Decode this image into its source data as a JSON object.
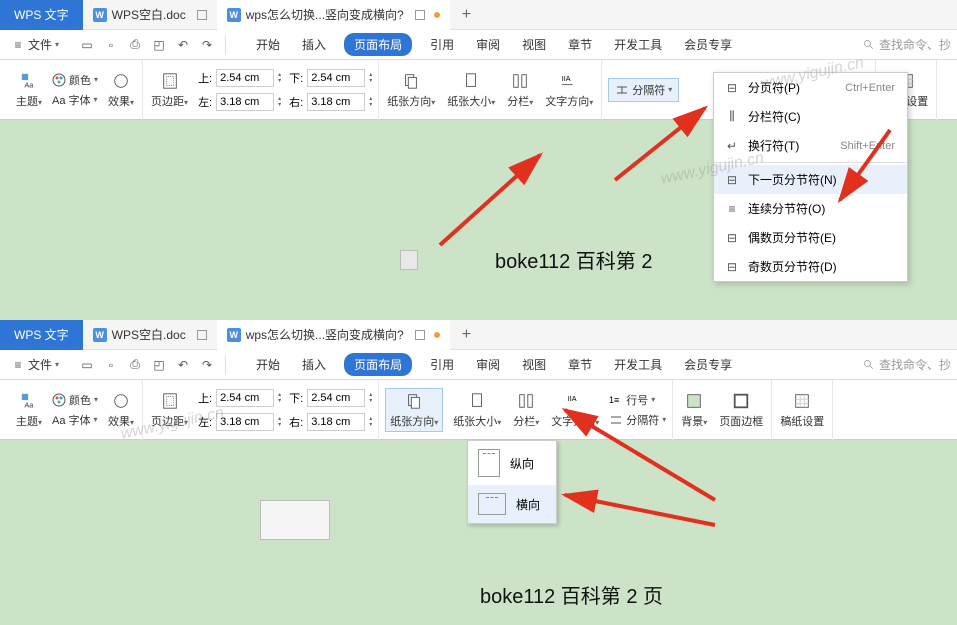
{
  "app_name": "WPS 文字",
  "tabs": {
    "t1": {
      "label": "WPS空白.doc"
    },
    "t2": {
      "label": "wps怎么切换...竖向变成横向?"
    }
  },
  "file_menu": "文件",
  "qat_icons": [
    "open",
    "save",
    "print",
    "preview",
    "undo",
    "redo"
  ],
  "ribbon_tabs": {
    "start": "开始",
    "insert": "插入",
    "page_layout": "页面布局",
    "reference": "引用",
    "review": "审阅",
    "view": "视图",
    "chapter": "章节",
    "dev": "开发工具",
    "member": "会员专享"
  },
  "search_placeholder": "查找命令、抄",
  "groups": {
    "theme": "主题",
    "font": "Aa 字体",
    "effect": "效果",
    "color": "颜色",
    "page_margin": "页边距",
    "orientation": "纸张方向",
    "paper_size": "纸张大小",
    "columns": "分栏",
    "text_dir": "文字方向",
    "line_no": "行号",
    "breaks": "分隔符",
    "background": "背景",
    "page_border": "页面边框",
    "paper_setting": "稿纸设置"
  },
  "margins": {
    "top_lbl": "上:",
    "bottom_lbl": "下:",
    "left_lbl": "左:",
    "right_lbl": "右:",
    "top": "2.54 cm",
    "bottom": "2.54 cm",
    "left": "3.18 cm",
    "right": "3.18 cm"
  },
  "breaks_menu": {
    "header": "分隔符",
    "page_break": "分页符(P)",
    "page_break_sc": "Ctrl+Enter",
    "column_break": "分栏符(C)",
    "line_break": "换行符(T)",
    "line_break_sc": "Shift+Enter",
    "next_page": "下一页分节符(N)",
    "continuous": "连续分节符(O)",
    "even_page": "偶数页分节符(E)",
    "odd_page": "奇数页分节符(D)"
  },
  "orientation_menu": {
    "portrait": "纵向",
    "landscape": "横向"
  },
  "page_text_1": "boke112 百科第 2",
  "page_text_2": "boke112 百科第 2 页",
  "watermark": "www.yigujin.cn"
}
